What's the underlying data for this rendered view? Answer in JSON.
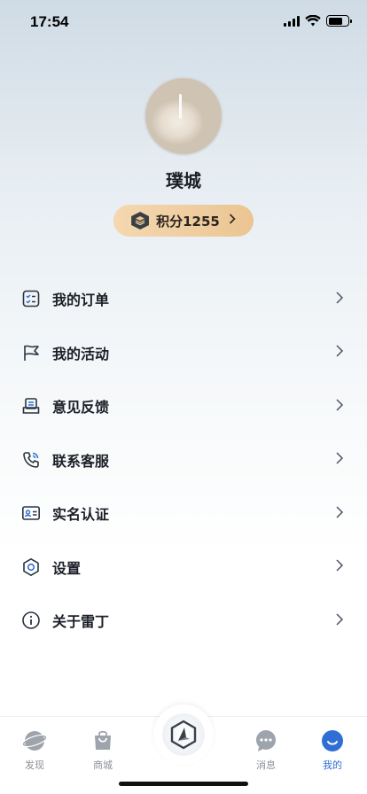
{
  "status_bar": {
    "time": "17:54"
  },
  "profile": {
    "name": "璞城",
    "points_label": "积分1255"
  },
  "menu": {
    "items": [
      {
        "label": "我的订单",
        "icon": "order-list-icon"
      },
      {
        "label": "我的活动",
        "icon": "flag-icon"
      },
      {
        "label": "意见反馈",
        "icon": "feedback-icon"
      },
      {
        "label": "联系客服",
        "icon": "phone-icon"
      },
      {
        "label": "实名认证",
        "icon": "id-card-icon"
      },
      {
        "label": "设置",
        "icon": "settings-icon"
      },
      {
        "label": "关于雷丁",
        "icon": "info-icon"
      }
    ]
  },
  "tab_bar": {
    "tabs": [
      {
        "label": "发现",
        "icon": "discover-icon",
        "active": false
      },
      {
        "label": "商城",
        "icon": "shop-bag-icon",
        "active": false
      },
      {
        "label": "",
        "icon": "brand-logo-icon",
        "active": false
      },
      {
        "label": "消息",
        "icon": "message-icon",
        "active": false
      },
      {
        "label": "我的",
        "icon": "profile-smile-icon",
        "active": true
      }
    ]
  },
  "colors": {
    "accent": "#2f6fd4",
    "points_pill": "#ebc593",
    "text_primary": "#1b1f27",
    "tab_inactive": "#8b9096"
  }
}
